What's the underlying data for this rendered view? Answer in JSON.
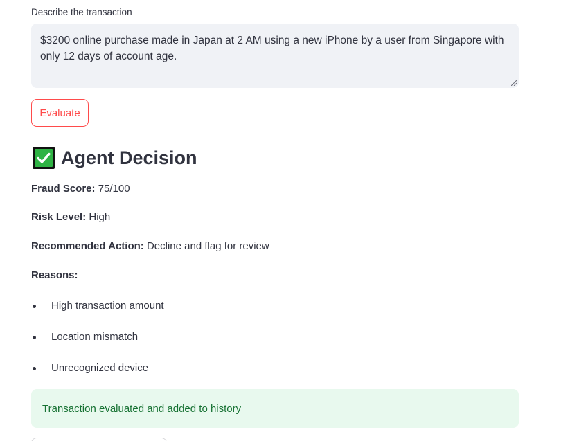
{
  "form": {
    "label": "Describe the transaction",
    "value": "$3200 online purchase made in Japan at 2 AM using a new iPhone by a user from Singapore with only 12 days of account age.",
    "button_label": "Evaluate"
  },
  "decision": {
    "icon": "check-mark-button-icon",
    "title": "Agent Decision",
    "fraud_score_label": "Fraud Score:",
    "fraud_score_value": "75/100",
    "risk_level_label": "Risk Level:",
    "risk_level_value": "High",
    "action_label": "Recommended Action:",
    "action_value": "Decline and flag for review",
    "reasons_label": "Reasons:",
    "reasons": [
      "High transaction amount",
      "Location mismatch",
      "Unrecognized device"
    ]
  },
  "status": {
    "message": "Transaction evaluated and added to history",
    "color": "#177233",
    "background": "#e8f9ee"
  },
  "theme": {
    "accent": "#ff4b4b",
    "check_green": "#2fb344"
  }
}
